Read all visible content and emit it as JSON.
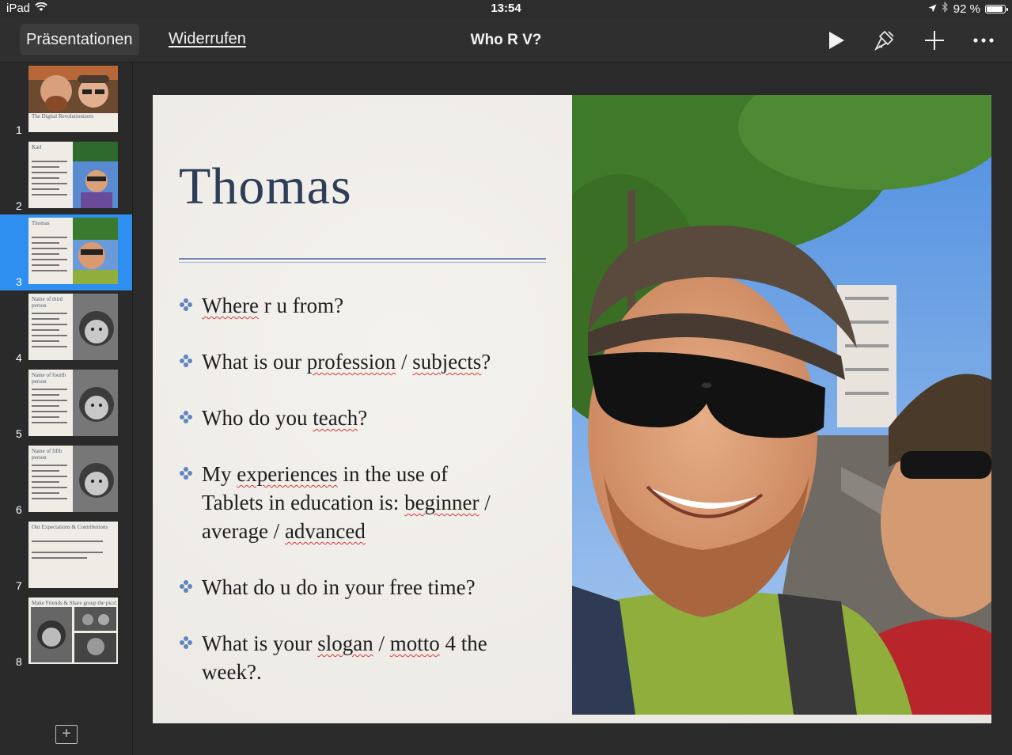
{
  "status": {
    "device": "iPad",
    "time": "13:54",
    "battery": "92 %",
    "battery_level": 0.92
  },
  "toolbar": {
    "presentations_label": "Präsentationen",
    "undo_label": "Widerrufen",
    "doc_title": "Who R V?"
  },
  "sidebar": {
    "slides": [
      {
        "num": "1",
        "title": "The Digital Revolutionizers",
        "selected": false
      },
      {
        "num": "2",
        "title": "Karl",
        "selected": false
      },
      {
        "num": "3",
        "title": "Thomas",
        "selected": true
      },
      {
        "num": "4",
        "title": "Name of third person",
        "selected": false
      },
      {
        "num": "5",
        "title": "Name of fourth person",
        "selected": false
      },
      {
        "num": "6",
        "title": "Name of fifth person",
        "selected": false
      },
      {
        "num": "7",
        "title": "Our Expectations & Contributions",
        "selected": false
      },
      {
        "num": "8",
        "title": "Make Friends & Share group the pics!",
        "selected": false
      }
    ]
  },
  "slide": {
    "title": "Thomas",
    "bullets": [
      {
        "lines": [
          [
            "Where",
            " r u from?"
          ]
        ]
      },
      {
        "lines": [
          [
            "What is our ",
            "profession",
            " / ",
            "subjects",
            "?"
          ]
        ]
      },
      {
        "lines": [
          [
            "Who do you ",
            "teach",
            "?"
          ]
        ]
      },
      {
        "lines": [
          [
            "My ",
            "experiences",
            " in the use of"
          ],
          [
            "Tablets in education is: ",
            "beginner",
            " /"
          ],
          [
            "average  /  ",
            "advanced"
          ]
        ]
      },
      {
        "lines": [
          [
            "What do u do in your free time?"
          ]
        ]
      },
      {
        "lines": [
          [
            "What is your ",
            "slogan",
            " / ",
            "motto",
            " 4 the"
          ],
          [
            "week?."
          ]
        ]
      }
    ]
  }
}
